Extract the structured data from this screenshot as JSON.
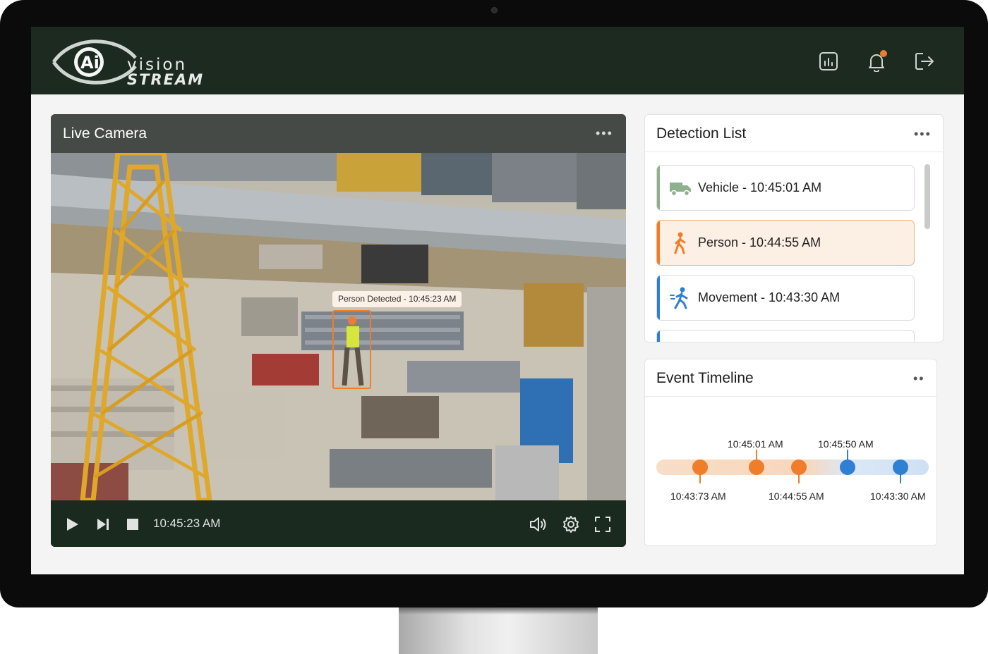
{
  "logo": {
    "line1": "vision",
    "line2": "STREAM",
    "badge": "Ai"
  },
  "header": {
    "icons": [
      "bar-chart-icon",
      "bell-icon",
      "logout-icon"
    ],
    "has_notification": true
  },
  "camera": {
    "title": "Live Camera",
    "menu": "•••",
    "detection_tag": "Person Detected - 10:45:23 AM",
    "time": "10:45:23 AM",
    "controls": [
      "play-icon",
      "skip-next-icon",
      "stop-icon",
      "volume-icon",
      "settings-gear-icon",
      "fullscreen-icon"
    ]
  },
  "detection_list": {
    "title": "Detection List",
    "menu": "•••",
    "items": [
      {
        "label": "Vehicle - 10:45:01 AM",
        "icon": "truck-icon",
        "color": "#8fb08d"
      },
      {
        "label": "Person - 10:44:55 AM",
        "icon": "person-walking-icon",
        "color": "#ef7d2a",
        "selected": true
      },
      {
        "label": "Movement - 10:43:30 AM",
        "icon": "person-running-icon",
        "color": "#2f7fd3"
      }
    ]
  },
  "timeline": {
    "title": "Event Timeline",
    "menu": "••",
    "top_labels": [
      "10:45:01 AM",
      "10:45:50 AM"
    ],
    "bottom_labels": [
      "10:43:73 AM",
      "10:44:55 AM",
      "10:43:30 AM"
    ]
  },
  "colors": {
    "header_bg": "#1c2a20",
    "accent_orange": "#ef7d2a",
    "accent_blue": "#2f7fd3",
    "accent_green": "#8fb08d"
  }
}
